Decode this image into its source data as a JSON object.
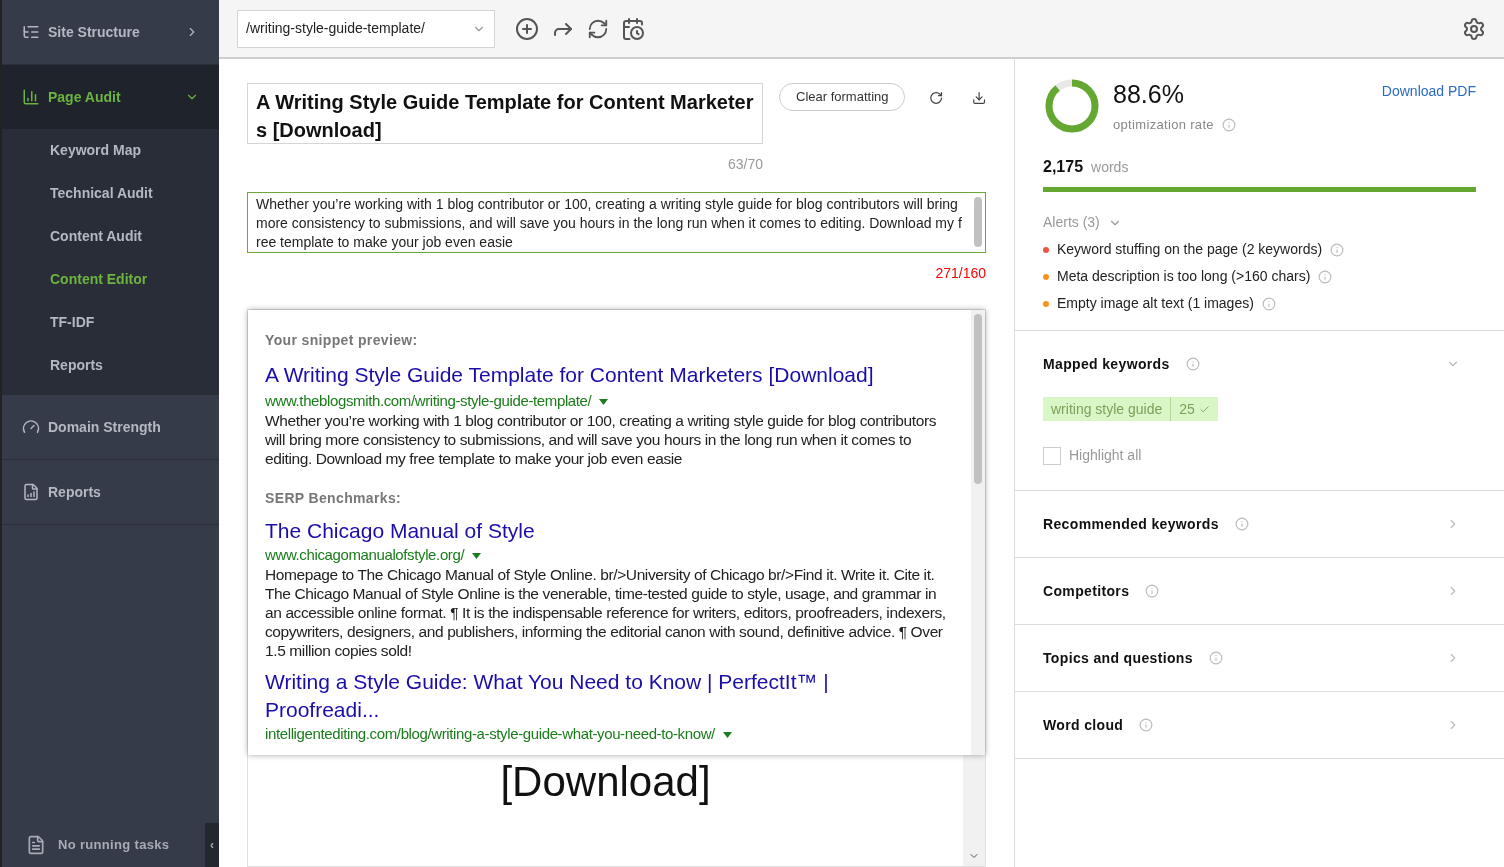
{
  "sidebar": {
    "items": [
      {
        "label": "Site Structure",
        "expanded": false,
        "selected": false
      },
      {
        "label": "Page Audit",
        "expanded": true,
        "selected": true,
        "children": [
          {
            "label": "Keyword Map",
            "selected": false
          },
          {
            "label": "Technical Audit",
            "selected": false
          },
          {
            "label": "Content Audit",
            "selected": false
          },
          {
            "label": "Content Editor",
            "selected": true
          },
          {
            "label": "TF-IDF",
            "selected": false
          },
          {
            "label": "Reports",
            "selected": false
          }
        ]
      },
      {
        "label": "Domain Strength",
        "expanded": false,
        "selected": false
      },
      {
        "label": "Reports",
        "expanded": false,
        "selected": false
      }
    ],
    "footer": "No running tasks",
    "collapse": "‹"
  },
  "toolbar": {
    "url": "/writing-style-guide-template/"
  },
  "editor": {
    "title": "A Writing Style Guide Template for Content Marketers [Download]",
    "title_count": "63/70",
    "title_over": false,
    "clear_button": "Clear formatting",
    "description": "Whether you’re working with 1 blog contributor or 100, creating a writing style guide for blog contributors will bring more consistency to submissions, and will save you hours in the long run when it comes to editing. Download my free template to make your job even easie",
    "description_count": "271/160",
    "description_over": true,
    "body_text": "[Download]"
  },
  "snippet": {
    "heading": "Your snippet preview:",
    "title": "A Writing Style Guide Template for Content Marketers [Download]",
    "url": "www.theblogsmith.com/writing-style-guide-template/",
    "text": "Whether you’re working with 1 blog contributor or 100, creating a writing style guide for blog contributors will bring more consistency to submissions, and will save you hours in the long run when it comes to editing. Download my free template to make your job even easie",
    "benchmarks_heading": "SERP Benchmarks:",
    "benchmarks": [
      {
        "title": "The Chicago Manual of Style",
        "url": "www.chicagomanualofstyle.org/",
        "text": "Homepage to The Chicago Manual of Style Online. br/>University of Chicago br/>Find it. Write it. Cite it. The Chicago Manual of Style Online is the venerable, time-tested guide to style, usage, and grammar in an accessible online format. ¶ It is the indispensable reference for writers, editors, proofreaders, indexers, copywriters, designers, and publishers, informing the editorial canon with sound, definitive advice. ¶ Over 1.5 million copies sold!"
      },
      {
        "title": "Writing a Style Guide: What You Need to Know | PerfectIt™ | Proofreadi...",
        "url": "intelligentediting.com/blog/writing-a-style-guide-what-you-need-to-know/"
      }
    ]
  },
  "score": {
    "percent": "88.6%",
    "level": 0.886,
    "label": "optimization rate",
    "download": "Download PDF"
  },
  "words": {
    "count": "2,175",
    "label": "words",
    "level": 1
  },
  "alerts": {
    "heading": "Alerts (3)",
    "items": [
      {
        "text": "Keyword stuffing on the page (2 keywords)",
        "color": "#f05443"
      },
      {
        "text": "Meta description is too long (>160 chars)",
        "color": "#f7941d"
      },
      {
        "text": "Empty image alt text (1 images)",
        "color": "#f7941d"
      }
    ]
  },
  "sections": [
    {
      "title": "Mapped keywords",
      "expanded": true,
      "keywords": [
        {
          "text": "writing style guide",
          "count": "25"
        }
      ],
      "highlight": {
        "label": "Highlight all",
        "checked": false
      }
    },
    {
      "title": "Recommended keywords",
      "expanded": false
    },
    {
      "title": "Competitors",
      "expanded": false
    },
    {
      "title": "Topics and questions",
      "expanded": false
    },
    {
      "title": "Word cloud",
      "expanded": false
    }
  ]
}
